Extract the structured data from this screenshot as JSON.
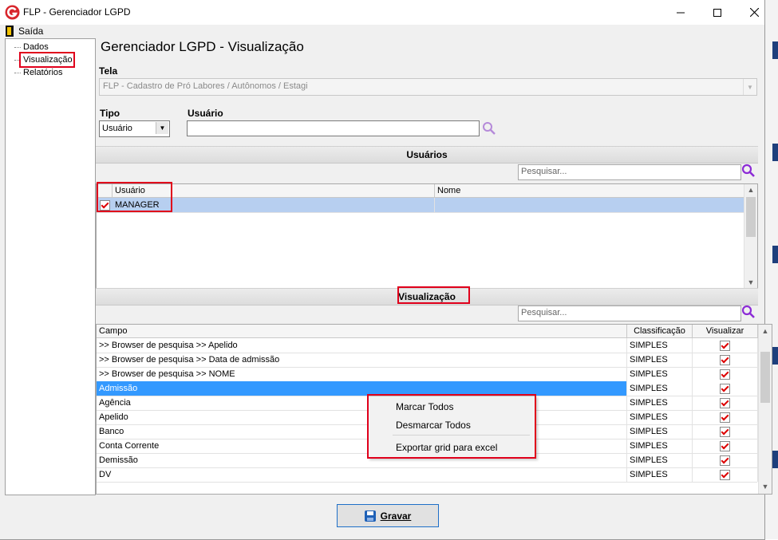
{
  "window": {
    "title": "FLP - Gerenciador LGPD",
    "minimize": "—",
    "maximize": "☐",
    "close": "✕"
  },
  "menu": {
    "exit_label": "Saída"
  },
  "tree": {
    "items": [
      {
        "label": "Dados"
      },
      {
        "label": "Visualização"
      },
      {
        "label": "Relatórios"
      }
    ]
  },
  "header": {
    "title": "Gerenciador LGPD - Visualização"
  },
  "tela": {
    "label": "Tela",
    "value": "FLP - Cadastro de Pró Labores / Autônomos / Estagi"
  },
  "tipo": {
    "label": "Tipo",
    "value": "Usuário"
  },
  "usuario": {
    "label": "Usuário",
    "value": ""
  },
  "usuarios_section": {
    "title": "Usuários",
    "search_placeholder": "Pesquisar...",
    "columns": [
      "Usuário",
      "Nome"
    ],
    "rows": [
      {
        "checked": true,
        "usuario": "MANAGER",
        "nome": ""
      }
    ]
  },
  "visualizacao_section": {
    "title": "Visualização",
    "search_placeholder": "Pesquisar...",
    "columns": [
      "Campo",
      "Classificação",
      "Visualizar"
    ],
    "rows": [
      {
        "campo": ">> Browser de pesquisa >> Apelido",
        "classificacao": "SIMPLES",
        "visualizar": true
      },
      {
        "campo": ">> Browser de pesquisa >> Data de admissão",
        "classificacao": "SIMPLES",
        "visualizar": true
      },
      {
        "campo": ">> Browser de pesquisa >> NOME",
        "classificacao": "SIMPLES",
        "visualizar": true
      },
      {
        "campo": "Admissão",
        "classificacao": "SIMPLES",
        "visualizar": true,
        "selected": true
      },
      {
        "campo": "Agência",
        "classificacao": "SIMPLES",
        "visualizar": true
      },
      {
        "campo": "Apelido",
        "classificacao": "SIMPLES",
        "visualizar": true
      },
      {
        "campo": "Banco",
        "classificacao": "SIMPLES",
        "visualizar": true
      },
      {
        "campo": "Conta Corrente",
        "classificacao": "SIMPLES",
        "visualizar": true
      },
      {
        "campo": "Demissão",
        "classificacao": "SIMPLES",
        "visualizar": true
      },
      {
        "campo": "DV",
        "classificacao": "SIMPLES",
        "visualizar": true
      }
    ]
  },
  "context_menu": {
    "items": [
      "Marcar Todos",
      "Desmarcar Todos",
      "Exportar grid para excel"
    ]
  },
  "footer": {
    "save_label": "Gravar"
  },
  "colors": {
    "selection": "#3399ff",
    "selection_light": "#b7cff0",
    "highlight_box": "#e0001b",
    "search_icon": "#8c2bd6",
    "logo_red": "#d8262c"
  }
}
